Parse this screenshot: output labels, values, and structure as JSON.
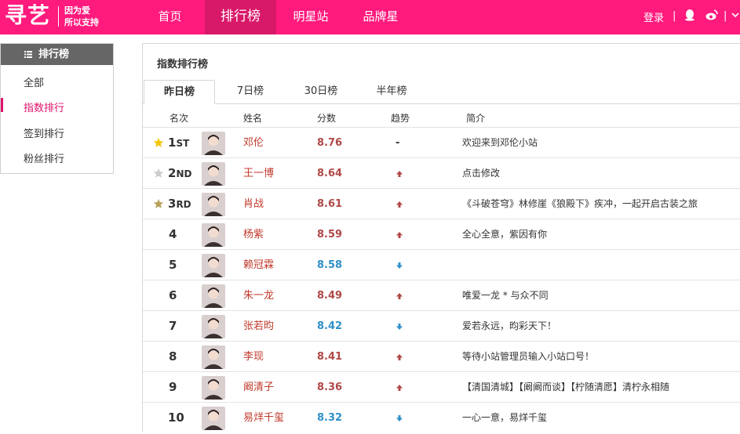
{
  "header": {
    "logo": "寻艺",
    "slogan_line1": "因为爱",
    "slogan_line2": "所以支持",
    "nav": [
      {
        "label": "首页",
        "active": false
      },
      {
        "label": "排行榜",
        "active": true
      },
      {
        "label": "明星站",
        "active": false
      },
      {
        "label": "品牌星",
        "active": false
      }
    ],
    "login": "登录",
    "sep": "|",
    "icons": [
      "qq-icon",
      "weibo-icon",
      "chevron-down-icon"
    ]
  },
  "sidebar": {
    "title": "排行榜",
    "items": [
      {
        "label": "全部",
        "active": false
      },
      {
        "label": "指数排行",
        "active": true
      },
      {
        "label": "签到排行",
        "active": false
      },
      {
        "label": "粉丝排行",
        "active": false
      }
    ]
  },
  "main": {
    "title": "指数排行榜",
    "tabs": [
      {
        "label": "昨日榜",
        "active": true
      },
      {
        "label": "7日榜",
        "active": false
      },
      {
        "label": "30日榜",
        "active": false
      },
      {
        "label": "半年榜",
        "active": false
      }
    ],
    "columns": [
      "名次",
      "姓名",
      "分数",
      "趋势",
      "简介"
    ],
    "trend_flat": "-",
    "rows": [
      {
        "rank": "1",
        "suffix": "ST",
        "star": "gold",
        "name": "邓伦",
        "score": "8.76",
        "trend": "flat",
        "intro": "欢迎来到邓伦小站"
      },
      {
        "rank": "2",
        "suffix": "ND",
        "star": "silver",
        "name": "王一博",
        "score": "8.64",
        "trend": "up",
        "intro": "点击修改"
      },
      {
        "rank": "3",
        "suffix": "RD",
        "star": "bronze",
        "name": "肖战",
        "score": "8.61",
        "trend": "up",
        "intro": "《斗破苍穹》林修崖《狼殿下》疾冲，一起开启古装之旅"
      },
      {
        "rank": "4",
        "suffix": "",
        "star": "",
        "name": "杨紫",
        "score": "8.59",
        "trend": "up",
        "intro": "全心全意，紫因有你"
      },
      {
        "rank": "5",
        "suffix": "",
        "star": "",
        "name": "赖冠霖",
        "score": "8.58",
        "trend": "down",
        "intro": ""
      },
      {
        "rank": "6",
        "suffix": "",
        "star": "",
        "name": "朱一龙",
        "score": "8.49",
        "trend": "up",
        "intro": "唯爱一龙 * 与众不同"
      },
      {
        "rank": "7",
        "suffix": "",
        "star": "",
        "name": "张若昀",
        "score": "8.42",
        "trend": "down",
        "intro": "爱若永远，昀彩天下！"
      },
      {
        "rank": "8",
        "suffix": "",
        "star": "",
        "name": "李现",
        "score": "8.41",
        "trend": "up",
        "intro": "等待小站管理员输入小站口号！"
      },
      {
        "rank": "9",
        "suffix": "",
        "star": "",
        "name": "阚清子",
        "score": "8.36",
        "trend": "up",
        "intro": "【清国清城】【阚阚而谈】【柠随清愿】清柠永相随"
      },
      {
        "rank": "10",
        "suffix": "",
        "star": "",
        "name": "易烊千玺",
        "score": "8.32",
        "trend": "down",
        "intro": "一心一意，易烊千玺"
      }
    ]
  },
  "colors": {
    "brand": "#ff1a7d",
    "brand_active": "#d81868",
    "up": "#b04848",
    "down": "#2f90c8",
    "gold_star": "#f5c400",
    "silver_star": "#cccccc",
    "bronze_star": "#b8a25a"
  }
}
